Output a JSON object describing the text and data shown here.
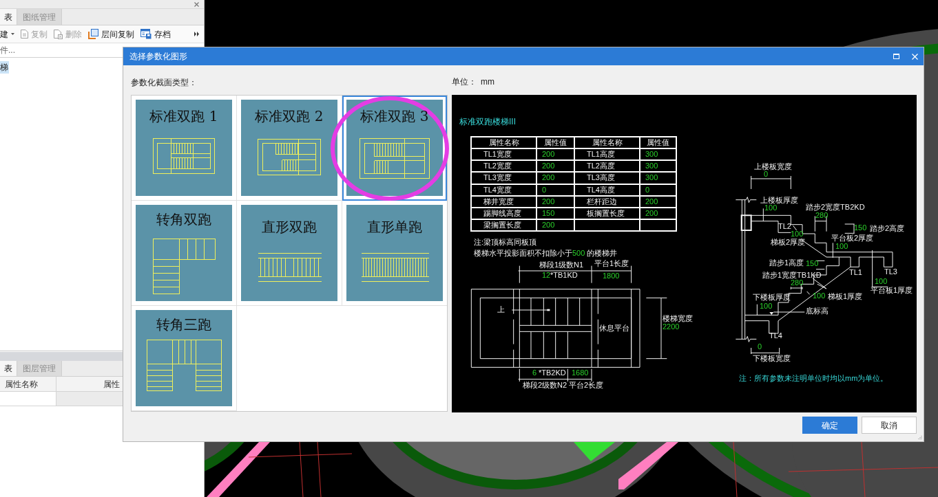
{
  "left_panel": {
    "tabs": [
      {
        "label": "表",
        "selected": true
      },
      {
        "label": "图纸管理",
        "selected": false
      }
    ],
    "toolbar": [
      {
        "label": "建",
        "kind": "new",
        "disabled": false
      },
      {
        "label": "复制",
        "kind": "copy",
        "disabled": true
      },
      {
        "label": "删除",
        "kind": "delete",
        "disabled": true
      },
      {
        "label": "层间复制",
        "kind": "floorcopy",
        "disabled": false
      },
      {
        "label": "存档",
        "kind": "archive",
        "disabled": false
      }
    ],
    "search": {
      "placeholder": "件..."
    },
    "tree": [
      {
        "label": "梯",
        "selected": true
      }
    ]
  },
  "properties_panel": {
    "tabs": [
      {
        "label": "表",
        "selected": true
      },
      {
        "label": "图层管理",
        "selected": false
      }
    ],
    "columns": [
      "属性名称",
      "属性"
    ]
  },
  "dialog": {
    "title": "选择参数化图形",
    "types_label": "参数化截面类型：",
    "unit_label": "单位：",
    "unit": "mm",
    "types": [
      {
        "label": "标准双跑 1",
        "kind": "double1",
        "selected": false
      },
      {
        "label": "标准双跑 2",
        "kind": "double2",
        "selected": false
      },
      {
        "label": "标准双跑 3",
        "kind": "double3",
        "selected": true
      },
      {
        "label": "转角双跑",
        "kind": "corner2",
        "selected": false
      },
      {
        "label": "直形双跑",
        "kind": "straight2",
        "selected": false
      },
      {
        "label": "直形单跑",
        "kind": "straight1",
        "selected": false
      },
      {
        "label": "转角三跑",
        "kind": "corner3",
        "selected": false
      }
    ],
    "preview": {
      "title": "标准双跑楼梯III",
      "table": {
        "columns": [
          "属性名称",
          "属性值",
          "属性名称",
          "属性值"
        ],
        "rows": [
          [
            "TL1宽度",
            "200",
            "TL1高度",
            "300"
          ],
          [
            "TL2宽度",
            "200",
            "TL2高度",
            "300"
          ],
          [
            "TL3宽度",
            "200",
            "TL3高度",
            "300"
          ],
          [
            "TL4宽度",
            "0",
            "TL4高度",
            "0"
          ],
          [
            "梯井宽度",
            "200",
            "栏杆距边",
            "200"
          ],
          [
            "踢脚线高度",
            "150",
            "板搁置长度",
            "200"
          ],
          [
            "梁搁置长度",
            "200"
          ]
        ]
      },
      "note": "注:梁顶标高同板顶",
      "note_2": {
        "text": "楼梯水平投影面积不扣除小于",
        "value": "500",
        "after": " 的楼梯井"
      },
      "plan_labels": [
        {
          "text": "梯段1级数N1",
          "kind": "name"
        },
        {
          "text": "平台1长度",
          "kind": "name"
        },
        {
          "text": "12",
          "kind": "value"
        },
        {
          "text": "*TB1KD",
          "kind": "name"
        },
        {
          "text": "1800",
          "kind": "value"
        },
        {
          "text": "上",
          "kind": "name"
        },
        {
          "text": "楼梯宽度",
          "kind": "name"
        },
        {
          "text": "休息平台",
          "kind": "name"
        },
        {
          "text": "2200",
          "kind": "value"
        },
        {
          "text": "6",
          "kind": "value"
        },
        {
          "text": "*TB2KD",
          "kind": "name"
        },
        {
          "text": "1680",
          "kind": "value"
        },
        {
          "text": "梯段2级数N2",
          "kind": "name"
        },
        {
          "text": "平台2长度",
          "kind": "name"
        }
      ],
      "section_labels": [
        {
          "text": "上楼板宽度",
          "kind": "name"
        },
        {
          "text": "0",
          "kind": "value"
        },
        {
          "text": "上楼板厚度",
          "kind": "name"
        },
        {
          "text": "100",
          "kind": "value"
        },
        {
          "text": "踏步2宽度TB2KD",
          "kind": "name"
        },
        {
          "text": "280",
          "kind": "value"
        },
        {
          "text": "TL2",
          "kind": "name"
        },
        {
          "text": "150",
          "kind": "value"
        },
        {
          "text": "踏步2高度",
          "kind": "name"
        },
        {
          "text": "100",
          "kind": "value"
        },
        {
          "text": "梯板2厚度",
          "kind": "name"
        },
        {
          "text": "平台板2厚度",
          "kind": "name"
        },
        {
          "text": "100",
          "kind": "value"
        },
        {
          "text": "踏步1高度",
          "kind": "name"
        },
        {
          "text": "150",
          "kind": "value"
        },
        {
          "text": "踏步1宽度TB1KD",
          "kind": "name"
        },
        {
          "text": "TL1",
          "kind": "name"
        },
        {
          "text": "TL3",
          "kind": "name"
        },
        {
          "text": "280",
          "kind": "value"
        },
        {
          "text": "100",
          "kind": "value"
        },
        {
          "text": "平台板1厚度",
          "kind": "name"
        },
        {
          "text": "下楼板厚度",
          "kind": "name"
        },
        {
          "text": "100",
          "kind": "value"
        },
        {
          "text": "梯板1厚度",
          "kind": "name"
        },
        {
          "text": "100",
          "kind": "value"
        },
        {
          "text": "底标高",
          "kind": "name"
        },
        {
          "text": "TL4",
          "kind": "name"
        },
        {
          "text": "0",
          "kind": "value"
        },
        {
          "text": "下楼板宽度",
          "kind": "name"
        }
      ],
      "footnote": "注：所有参数未注明单位时均以mm为单位。"
    },
    "buttons": [
      {
        "label": "确定",
        "primary": true
      },
      {
        "label": "取消",
        "primary": false
      }
    ]
  }
}
